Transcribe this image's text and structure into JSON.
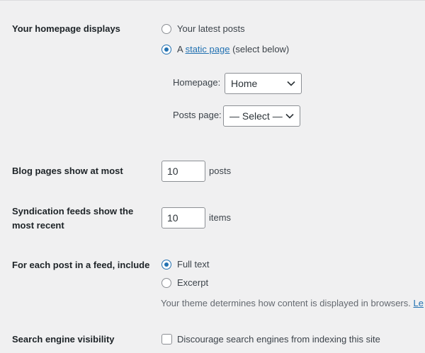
{
  "homepage_displays": {
    "label": "Your homepage displays",
    "options": [
      {
        "label": "Your latest posts",
        "checked": false
      },
      {
        "prefix": "A ",
        "link_text": "static page",
        "suffix": " (select below)",
        "checked": true
      }
    ],
    "homepage_label": "Homepage:",
    "homepage_value": "Home",
    "posts_page_label": "Posts page:",
    "posts_page_value": "— Select —"
  },
  "blog_pages": {
    "label": "Blog pages show at most",
    "value": "10",
    "unit": "posts"
  },
  "syndication": {
    "label_line1": "Syndication feeds show the",
    "label_line2": "most recent",
    "value": "10",
    "unit": "items"
  },
  "feed_include": {
    "label": "For each post in a feed, include",
    "options": [
      {
        "label": "Full text",
        "checked": true
      },
      {
        "label": "Excerpt",
        "checked": false
      }
    ],
    "description": "Your theme determines how content is displayed in browsers.",
    "description_link": "Le"
  },
  "search_visibility": {
    "label": "Search engine visibility",
    "checkbox_label": "Discourage search engines from indexing this site",
    "checked": false
  },
  "colors": {
    "accent": "#2271b1",
    "background": "#f0f0f1",
    "heading": "#1d2327",
    "text": "#3c434a",
    "muted": "#646970"
  }
}
